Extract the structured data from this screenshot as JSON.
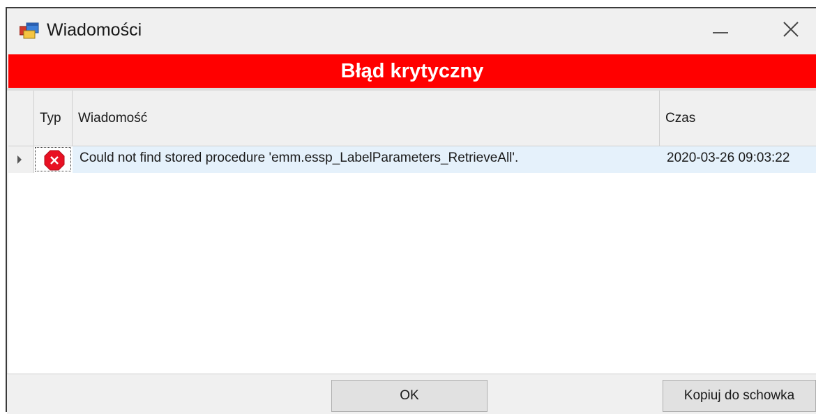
{
  "window": {
    "title": "Wiadomości",
    "minimize_glyph": "—",
    "close_glyph": "✕"
  },
  "banner": {
    "text": "Błąd krytyczny",
    "color": "#ff0000"
  },
  "grid": {
    "columns": {
      "type": "Typ",
      "message": "Wiadomość",
      "time": "Czas"
    },
    "rows": [
      {
        "type_icon": "error-icon",
        "message": "Could not find stored procedure 'emm.essp_LabelParameters_RetrieveAll'.",
        "time": "2020-03-26 09:03:22"
      }
    ],
    "selected_row_color": "#e5f1fb"
  },
  "footer": {
    "ok_label": "OK",
    "copy_label": "Kopiuj do schowka"
  },
  "icons": {
    "app": "app-window-icon",
    "error": "error-icon",
    "row_indicator": "row-arrow-icon"
  }
}
